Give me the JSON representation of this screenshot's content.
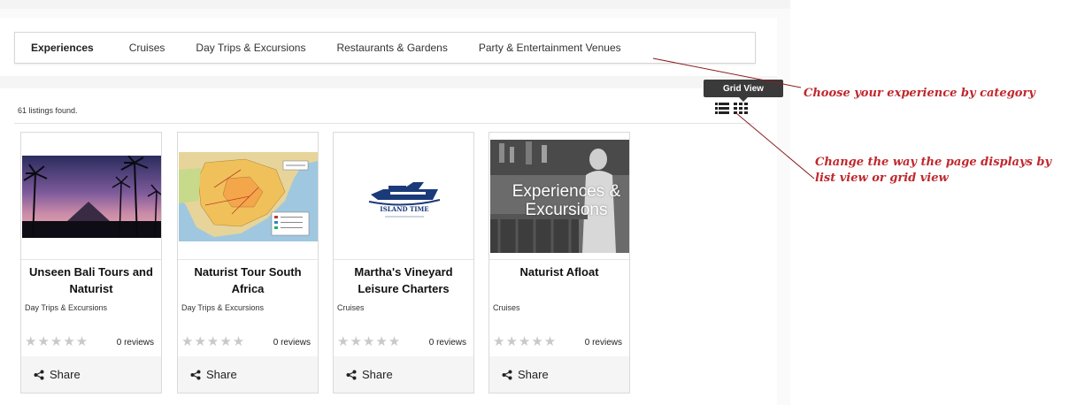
{
  "categories": {
    "items": [
      {
        "label": "Experiences"
      },
      {
        "label": "Cruises"
      },
      {
        "label": "Day Trips & Excursions"
      },
      {
        "label": "Restaurants & Gardens"
      },
      {
        "label": "Party & Entertainment Venues"
      }
    ]
  },
  "results": {
    "count_text": "61 listings found."
  },
  "view": {
    "tooltip": "Grid View",
    "icons": [
      "list-view-icon",
      "grid-view-icon"
    ]
  },
  "annotations": {
    "category_note": "Choose your experience by category",
    "view_note": "Change the way the page displays by list view or grid view"
  },
  "cards": [
    {
      "title": "Unseen Bali Tours and Naturist",
      "category": "Day Trips & Excursions",
      "reviews": "0 reviews",
      "share": "Share",
      "rating": 0,
      "image": "bali-sunset-photo"
    },
    {
      "title": "Naturist Tour South Africa",
      "category": "Day Trips & Excursions",
      "reviews": "0 reviews",
      "share": "Share",
      "rating": 0,
      "image": "south-africa-map"
    },
    {
      "title": "Martha's Vineyard Leisure Charters",
      "category": "Cruises",
      "reviews": "0 reviews",
      "share": "Share",
      "rating": 0,
      "image": "island-time-boat-logo",
      "image_text": "ISLAND TIME"
    },
    {
      "title": "Naturist Afloat",
      "category": "Cruises",
      "reviews": "0 reviews",
      "share": "Share",
      "rating": 0,
      "image": "bar-photo",
      "image_text": "Experiences & Excursions"
    }
  ],
  "colors": {
    "annotation": "#c0272d",
    "tooltip_bg": "#3a3a3a",
    "star_empty": "#c9c9c9"
  }
}
